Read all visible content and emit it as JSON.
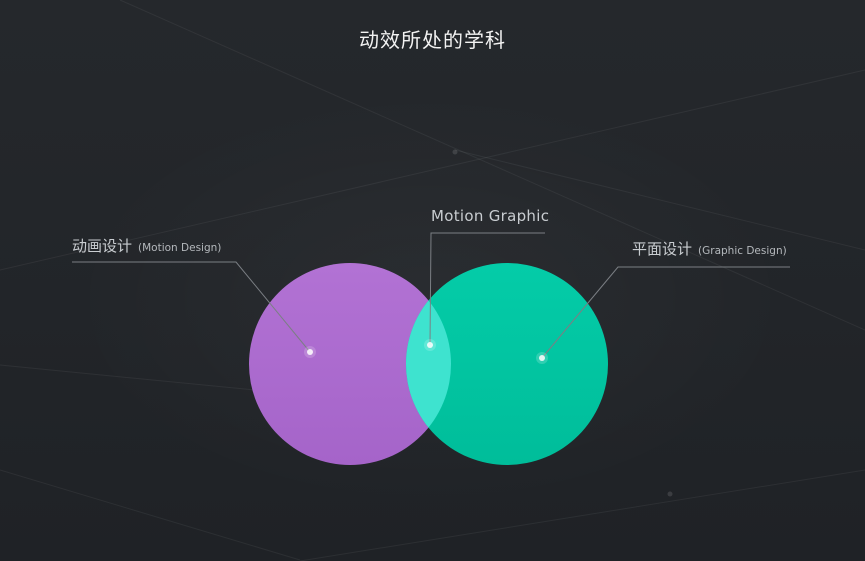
{
  "title": "动效所处的学科",
  "sets": {
    "left": {
      "name": "动画设计",
      "name_en": "(Motion Design)",
      "color": "#ad6bd0"
    },
    "right": {
      "name": "平面设计",
      "name_en": "(Graphic Design)",
      "color": "#00c9a4"
    },
    "intersection": {
      "name": "Motion Graphic",
      "color": "#3ee3cf"
    }
  },
  "colors": {
    "background": "#23262a",
    "leader_line": "#7b7f84",
    "dot": "#ffffff"
  }
}
